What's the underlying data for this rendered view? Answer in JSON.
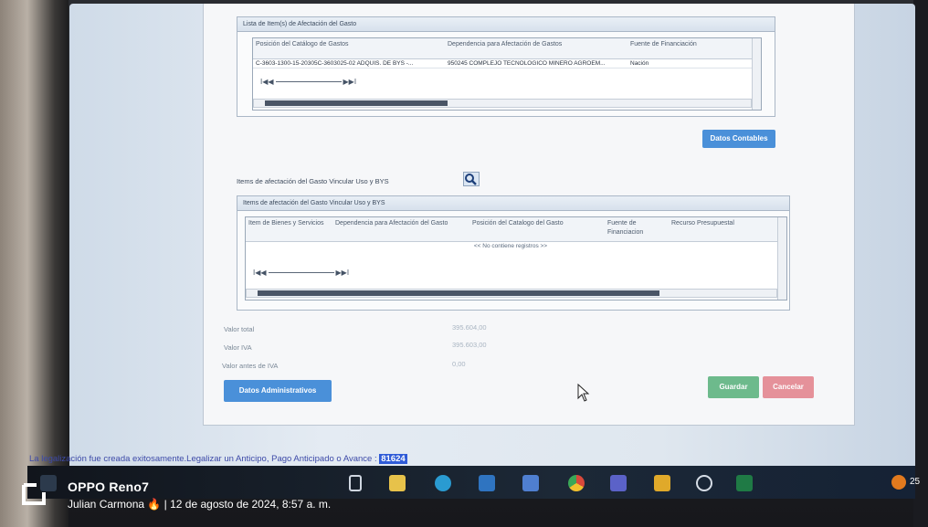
{
  "section1": {
    "title": "Lista de Item(s) de Afectación del Gasto",
    "columns": [
      "Posición del Catálogo de Gastos",
      "Dependencia para Afectación de Gastos",
      "Fuente de Financiación"
    ],
    "rows": [
      [
        "C-3603-1300-15-20305C-3603025-02 ADQUIS. DE BYS -...",
        "950245 COMPLEJO TECNOLOGICO MINERO AGROEM...",
        "Nación"
      ]
    ],
    "pager": "I◀ ◀ ▶ ▶I"
  },
  "buttons": {
    "datos_contables": "Datos Contables",
    "datos_administrativos": "Datos Administrativos",
    "guardar": "Guardar",
    "cancelar": "Cancelar"
  },
  "section2": {
    "search_label": "Items de afectación del Gasto Vincular Uso y BYS",
    "title": "Items de afectación del Gasto Vincular Uso y BYS",
    "columns": [
      "Item de Bienes y Servicios",
      "Dependencia para Afectación del Gasto",
      "Posición del Catalogo del Gasto",
      "Fuente de Financiacion",
      "Recurso Presupuestal"
    ],
    "empty_text": "<< No contiene registros >>"
  },
  "totals": {
    "valor_total_label": "Valor total",
    "valor_total": "395.604,00",
    "valor_iva_label": "Valor IVA",
    "valor_iva": "395.603,00",
    "valor_antes_iva_label": "Valor antes de IVA",
    "valor_antes_iva": "0,00"
  },
  "status": {
    "message": "La legalización fue creada exitosamente.Legalizar un Anticipo, Pago Anticipado o Avance :",
    "id": "81624"
  },
  "taskbar": {
    "icons": [
      "start-icon",
      "task-view-icon",
      "file-explorer-icon",
      "edge-icon",
      "mail-icon",
      "app-icon",
      "chrome-icon",
      "teams-icon",
      "lock-app-icon",
      "refresh-app-icon",
      "excel-icon"
    ],
    "tray_text": "25"
  },
  "watermark": {
    "brand": "OPPO Reno7",
    "caption": "Julian Carmona 🔥 | 12 de agosto de 2024, 8:57 a. m."
  },
  "colors": {
    "primary_button": "#4a90d9",
    "save_button": "#56b07a",
    "cancel_button": "#e3808a",
    "highlight": "#2f5bd7"
  }
}
